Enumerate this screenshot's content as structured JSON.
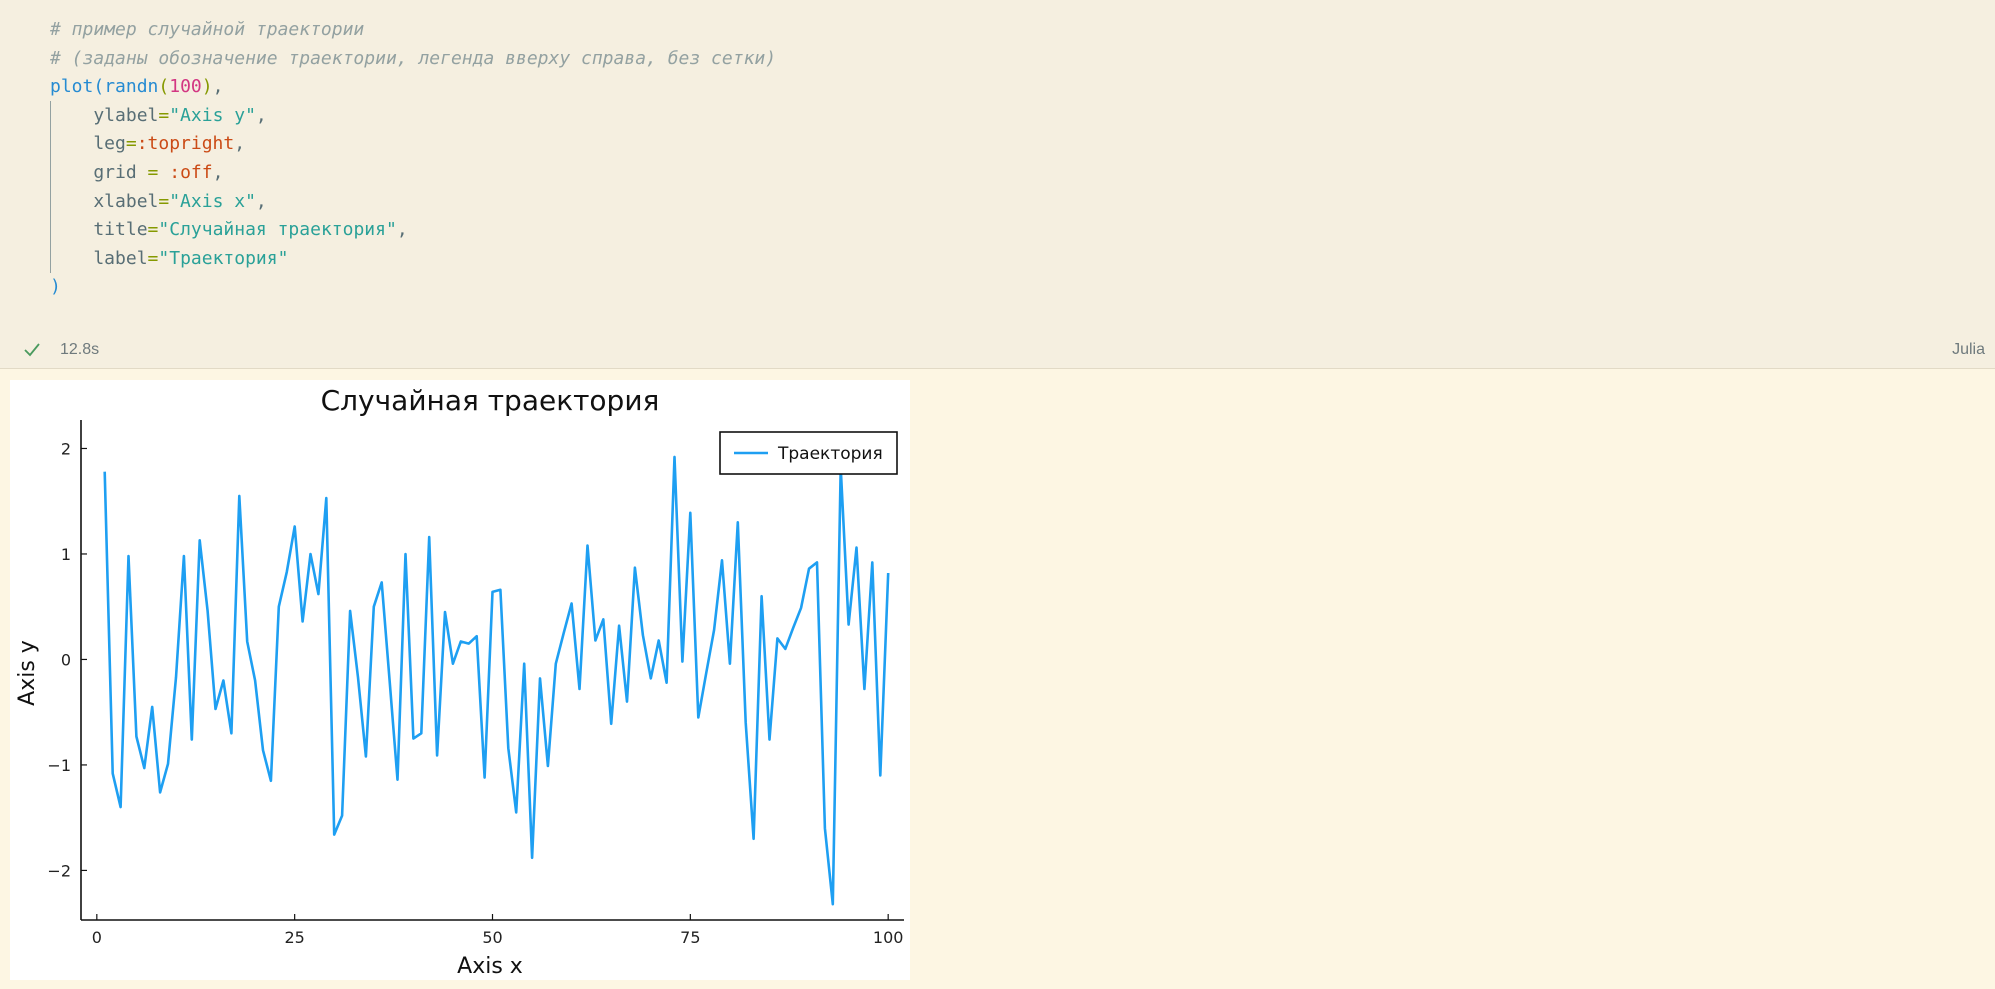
{
  "cell": {
    "code_lines": [
      [
        {
          "t": "# пример случайной траектории",
          "c": "cm"
        }
      ],
      [
        {
          "t": "# (заданы обозначение траектории, легенда вверху справа, без сетки)",
          "c": "cm"
        }
      ],
      [
        {
          "t": "plot",
          "c": "fn"
        },
        {
          "t": "(",
          "c": "paren"
        },
        {
          "t": "randn",
          "c": "fn"
        },
        {
          "t": "(",
          "c": "op"
        },
        {
          "t": "100",
          "c": "num"
        },
        {
          "t": ")",
          "c": "op"
        },
        {
          "t": ",",
          "c": "kw"
        }
      ],
      [
        {
          "t": "    ylabel",
          "c": "kw"
        },
        {
          "t": "=",
          "c": "op"
        },
        {
          "t": "\"Axis y\"",
          "c": "str"
        },
        {
          "t": ",",
          "c": "kw"
        }
      ],
      [
        {
          "t": "    leg",
          "c": "kw"
        },
        {
          "t": "=",
          "c": "op"
        },
        {
          "t": ":topright",
          "c": "sym"
        },
        {
          "t": ",",
          "c": "kw"
        }
      ],
      [
        {
          "t": "    grid ",
          "c": "kw"
        },
        {
          "t": "=",
          "c": "op"
        },
        {
          "t": " ",
          "c": "kw"
        },
        {
          "t": ":off",
          "c": "sym"
        },
        {
          "t": ",",
          "c": "kw"
        }
      ],
      [
        {
          "t": "    xlabel",
          "c": "kw"
        },
        {
          "t": "=",
          "c": "op"
        },
        {
          "t": "\"Axis x\"",
          "c": "str"
        },
        {
          "t": ",",
          "c": "kw"
        }
      ],
      [
        {
          "t": "    title",
          "c": "kw"
        },
        {
          "t": "=",
          "c": "op"
        },
        {
          "t": "\"Случайная траектория\"",
          "c": "str"
        },
        {
          "t": ",",
          "c": "kw"
        }
      ],
      [
        {
          "t": "    label",
          "c": "kw"
        },
        {
          "t": "=",
          "c": "op"
        },
        {
          "t": "\"Траектория\"",
          "c": "str"
        }
      ],
      [
        {
          "t": ")",
          "c": "paren"
        }
      ]
    ],
    "status": {
      "icon": "check-icon",
      "exec_time": "12.8s",
      "language": "Julia"
    }
  },
  "colors": {
    "series": "#1e9ff2",
    "check": "#4a9a5e"
  },
  "chart_data": {
    "type": "line",
    "title": "Случайная траектория",
    "xlabel": "Axis x",
    "ylabel": "Axis y",
    "legend": "top-right",
    "grid": false,
    "xlim": [
      -2,
      102
    ],
    "ylim": [
      -2.47,
      2.27
    ],
    "xticks": [
      0,
      25,
      50,
      75,
      100
    ],
    "yticks": [
      -2,
      -1,
      0,
      1,
      2
    ],
    "xtick_labels": [
      "0",
      "25",
      "50",
      "75",
      "100"
    ],
    "ytick_labels": [
      "−2",
      "−1",
      "0",
      "1",
      "2"
    ],
    "series": [
      {
        "name": "Траектория",
        "x": [
          1,
          2,
          3,
          4,
          5,
          6,
          7,
          8,
          9,
          10,
          11,
          12,
          13,
          14,
          15,
          16,
          17,
          18,
          19,
          20,
          21,
          22,
          23,
          24,
          25,
          26,
          27,
          28,
          29,
          30,
          31,
          32,
          33,
          34,
          35,
          36,
          37,
          38,
          39,
          40,
          41,
          42,
          43,
          44,
          45,
          46,
          47,
          48,
          49,
          50,
          51,
          52,
          53,
          54,
          55,
          56,
          57,
          58,
          59,
          60,
          61,
          62,
          63,
          64,
          65,
          66,
          67,
          68,
          69,
          70,
          71,
          72,
          73,
          74,
          75,
          76,
          77,
          78,
          79,
          80,
          81,
          82,
          83,
          84,
          85,
          86,
          87,
          88,
          89,
          90,
          91,
          92,
          93,
          94,
          95,
          96,
          97,
          98,
          99,
          100
        ],
        "values": [
          1.78,
          -1.08,
          -1.4,
          0.98,
          -0.73,
          -1.03,
          -0.45,
          -1.26,
          -0.99,
          -0.17,
          0.98,
          -0.76,
          1.13,
          0.46,
          -0.47,
          -0.2,
          -0.7,
          1.55,
          0.17,
          -0.2,
          -0.86,
          -1.15,
          0.5,
          0.83,
          1.26,
          0.36,
          1.0,
          0.62,
          1.53,
          -1.66,
          -1.48,
          0.46,
          -0.17,
          -0.92,
          0.5,
          0.73,
          -0.2,
          -1.14,
          1.0,
          -0.75,
          -0.7,
          1.16,
          -0.91,
          0.45,
          -0.04,
          0.17,
          0.15,
          0.22,
          -1.12,
          0.64,
          0.66,
          -0.84,
          -1.45,
          -0.04,
          -1.88,
          -0.18,
          -1.01,
          -0.04,
          0.25,
          0.53,
          -0.28,
          1.08,
          0.18,
          0.38,
          -0.61,
          0.32,
          -0.4,
          0.87,
          0.23,
          -0.18,
          0.18,
          -0.22,
          1.92,
          -0.02,
          1.39,
          -0.55,
          -0.13,
          0.28,
          0.94,
          -0.04,
          1.3,
          -0.6,
          -1.7,
          0.6,
          -0.76,
          0.2,
          0.1,
          0.3,
          0.49,
          0.86,
          0.92,
          -1.6,
          -2.32,
          1.82,
          0.33,
          1.06,
          -0.28,
          0.92,
          -1.1,
          0.82
        ]
      }
    ]
  }
}
